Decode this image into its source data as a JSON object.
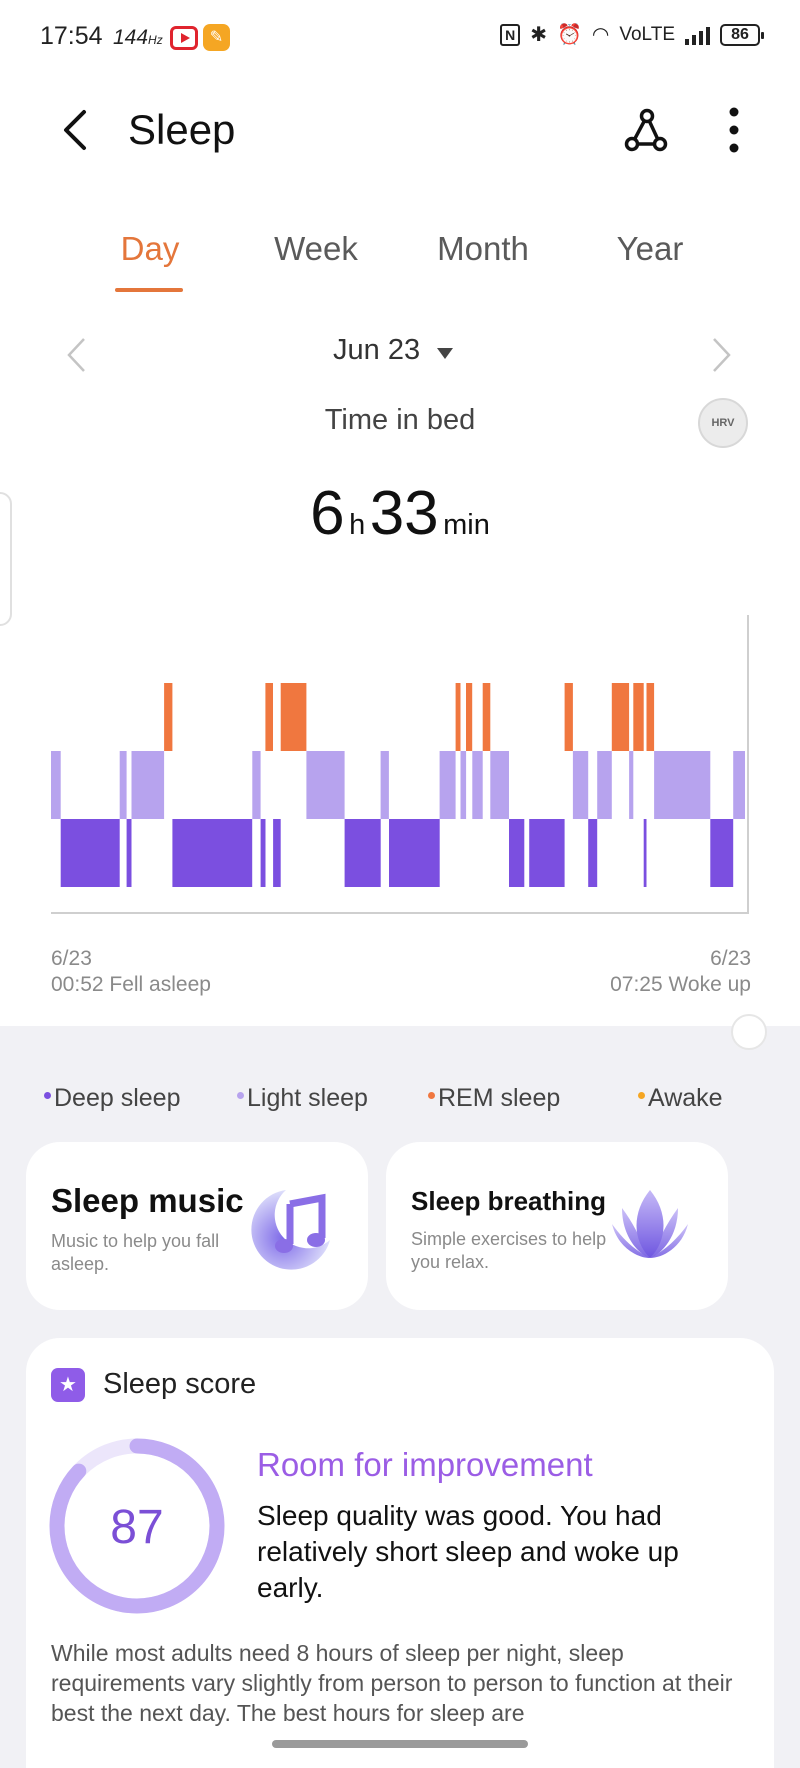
{
  "status_bar": {
    "time": "17:54",
    "refresh": "144",
    "refresh_unit": "Hz",
    "network": "VoLTE",
    "battery": "86"
  },
  "header": {
    "title": "Sleep"
  },
  "tabs": [
    {
      "label": "Day",
      "active": true
    },
    {
      "label": "Week",
      "active": false
    },
    {
      "label": "Month",
      "active": false
    },
    {
      "label": "Year",
      "active": false
    }
  ],
  "date_nav": {
    "date": "Jun 23"
  },
  "summary": {
    "label": "Time in bed",
    "hours": "6",
    "hours_unit": "h",
    "minutes": "33",
    "minutes_unit": "min",
    "hrv_badge": "HRV"
  },
  "chart_data": {
    "type": "bar",
    "series_levels": [
      "rem",
      "light",
      "deep"
    ],
    "colors": {
      "deep": "#7b4fe0",
      "light": "#b7a3ee",
      "rem": "#f0773f",
      "awake": "#f5a623"
    },
    "segments": [
      {
        "stage": "light",
        "start": 0.0,
        "end": 0.014
      },
      {
        "stage": "deep",
        "start": 0.014,
        "end": 0.099
      },
      {
        "stage": "light",
        "start": 0.099,
        "end": 0.109
      },
      {
        "stage": "deep",
        "start": 0.109,
        "end": 0.116
      },
      {
        "stage": "light",
        "start": 0.116,
        "end": 0.163
      },
      {
        "stage": "rem",
        "start": 0.163,
        "end": 0.175
      },
      {
        "stage": "deep",
        "start": 0.175,
        "end": 0.29
      },
      {
        "stage": "light",
        "start": 0.29,
        "end": 0.302
      },
      {
        "stage": "deep",
        "start": 0.302,
        "end": 0.309
      },
      {
        "stage": "rem",
        "start": 0.309,
        "end": 0.32
      },
      {
        "stage": "deep",
        "start": 0.32,
        "end": 0.331
      },
      {
        "stage": "rem",
        "start": 0.331,
        "end": 0.368
      },
      {
        "stage": "light",
        "start": 0.368,
        "end": 0.423
      },
      {
        "stage": "deep",
        "start": 0.423,
        "end": 0.475
      },
      {
        "stage": "light",
        "start": 0.475,
        "end": 0.487
      },
      {
        "stage": "deep",
        "start": 0.487,
        "end": 0.56
      },
      {
        "stage": "light",
        "start": 0.56,
        "end": 0.583
      },
      {
        "stage": "rem",
        "start": 0.583,
        "end": 0.59
      },
      {
        "stage": "light",
        "start": 0.59,
        "end": 0.598
      },
      {
        "stage": "rem",
        "start": 0.598,
        "end": 0.607
      },
      {
        "stage": "light",
        "start": 0.607,
        "end": 0.622
      },
      {
        "stage": "rem",
        "start": 0.622,
        "end": 0.633
      },
      {
        "stage": "light",
        "start": 0.633,
        "end": 0.66
      },
      {
        "stage": "deep",
        "start": 0.66,
        "end": 0.682
      },
      {
        "stage": "deep",
        "start": 0.689,
        "end": 0.74
      },
      {
        "stage": "rem",
        "start": 0.74,
        "end": 0.752
      },
      {
        "stage": "light",
        "start": 0.752,
        "end": 0.774
      },
      {
        "stage": "deep",
        "start": 0.774,
        "end": 0.787
      },
      {
        "stage": "light",
        "start": 0.787,
        "end": 0.808
      },
      {
        "stage": "rem",
        "start": 0.808,
        "end": 0.833
      },
      {
        "stage": "light",
        "start": 0.833,
        "end": 0.839
      },
      {
        "stage": "rem",
        "start": 0.839,
        "end": 0.854
      },
      {
        "stage": "deep",
        "start": 0.854,
        "end": 0.858
      },
      {
        "stage": "rem",
        "start": 0.858,
        "end": 0.869
      },
      {
        "stage": "light",
        "start": 0.869,
        "end": 0.95
      },
      {
        "stage": "deep",
        "start": 0.95,
        "end": 0.983
      },
      {
        "stage": "light",
        "start": 0.983,
        "end": 1.0
      }
    ],
    "x_start": "00:52",
    "x_end": "07:25"
  },
  "axis": {
    "start_date": "6/23",
    "start_label": "00:52 Fell asleep",
    "end_date": "6/23",
    "end_label": "07:25 Woke up"
  },
  "legend": [
    {
      "label": "Deep sleep",
      "color": "#7b4fe0"
    },
    {
      "label": "Light sleep",
      "color": "#b7a3ee"
    },
    {
      "label": "REM sleep",
      "color": "#f0773f"
    },
    {
      "label": "Awake",
      "color": "#f5a623"
    }
  ],
  "cards": {
    "music": {
      "title": "Sleep music",
      "subtitle": "Music to help you fall asleep."
    },
    "breathing": {
      "title": "Sleep breathing",
      "subtitle": "Simple exercises to help you relax."
    }
  },
  "score": {
    "title": "Sleep score",
    "value": "87",
    "percent": 87,
    "headline": "Room for improvement",
    "summary": "Sleep quality was good. You had relatively short sleep and woke up early.",
    "body": "While most adults need 8 hours of sleep per night, sleep requirements vary slightly from person to person to function at their best the next day. The best hours for sleep are"
  }
}
